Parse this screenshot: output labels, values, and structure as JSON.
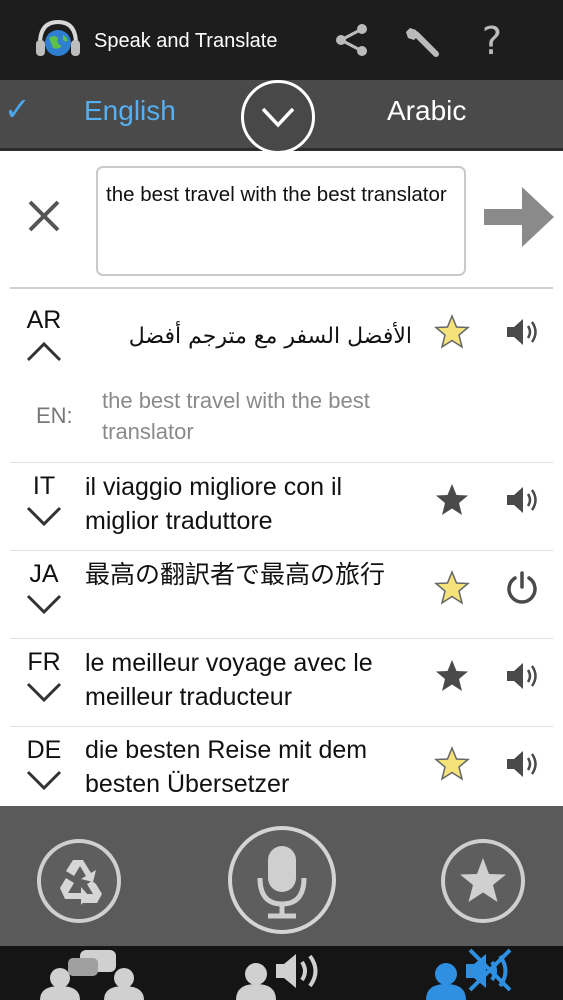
{
  "app": {
    "title": "Speak and Translate"
  },
  "language_bar": {
    "source": "English",
    "target": "Arabic",
    "check": "✓"
  },
  "input": {
    "value": "the best travel with the best translator"
  },
  "translations": [
    {
      "code": "AR",
      "text": "الأفضل السفر مع مترجم أفضل",
      "favorite": true,
      "audio": "speaker",
      "expanded": true,
      "source_code": "EN:",
      "source_text": "the best travel with the best translator"
    },
    {
      "code": "IT",
      "text": "il viaggio migliore con il miglior traduttore",
      "favorite": false,
      "audio": "speaker"
    },
    {
      "code": "JA",
      "text": "最高の翻訳者で最高の旅行",
      "favorite": true,
      "audio": "power"
    },
    {
      "code": "FR",
      "text": "le meilleur voyage avec le meilleur traducteur",
      "favorite": false,
      "audio": "speaker"
    },
    {
      "code": "DE",
      "text": "die besten Reise mit dem besten Übersetzer",
      "favorite": true,
      "audio": "speaker"
    }
  ],
  "colors": {
    "accent": "#56aff0",
    "star_fav": "#f6e27a",
    "star_plain": "#4a4a4a",
    "topbar": "#1d1d1d",
    "toolbar": "#5a5a5a"
  }
}
